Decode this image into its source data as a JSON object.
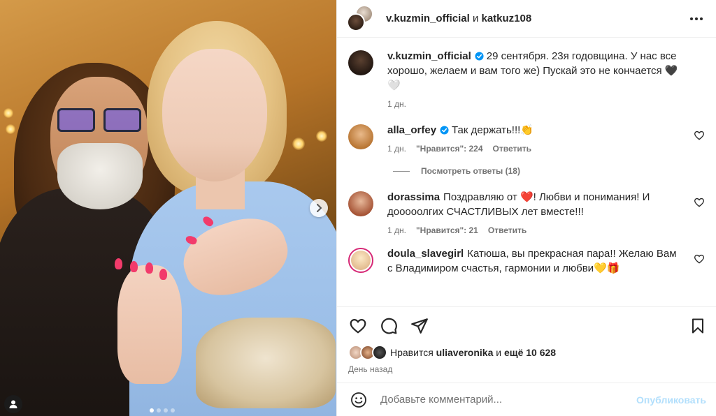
{
  "header": {
    "user1": "v.kuzmin_official",
    "conjunction": "и",
    "user2": "katkuz108"
  },
  "caption": {
    "username": "v.kuzmin_official",
    "text": "29 сентября. 23я годовщина. У нас все хорошо, желаем и вам того же) Пускай это не кончается 🖤 🤍",
    "time": "1 дн."
  },
  "comments": [
    {
      "username": "alla_orfey",
      "verified": true,
      "text": "Так держать!!!👏",
      "time": "1 дн.",
      "likes": "\"Нравится\": 224",
      "reply": "Ответить",
      "view_replies": "Посмотреть ответы (18)"
    },
    {
      "username": "dorassima",
      "verified": false,
      "text": "Поздравляю от ❤️! Любви и понимания! И дооооолгих СЧАСТЛИВЫХ лет вместе!!!",
      "time": "1 дн.",
      "likes": "\"Нравится\": 21",
      "reply": "Ответить"
    },
    {
      "username": "doula_slavegirl",
      "verified": false,
      "text": "Катюша, вы прекрасная пара!! Желаю Вам с Владимиром счастья, гармонии и любви💛🎁"
    }
  ],
  "likes": {
    "prefix": "Нравится",
    "user": "uliaveronika",
    "middle": "и",
    "others": "ещё 10 628"
  },
  "time_ago": "День назад",
  "add_comment": {
    "placeholder": "Добавьте комментарий...",
    "publish": "Опубликовать"
  },
  "carousel": {
    "total_slides": 4,
    "active_slide": 1
  },
  "colors": {
    "verified": "#0095f6",
    "publish_disabled": "#b2dffc",
    "nail": "#f23b6b",
    "story_ring": "#d62976"
  }
}
